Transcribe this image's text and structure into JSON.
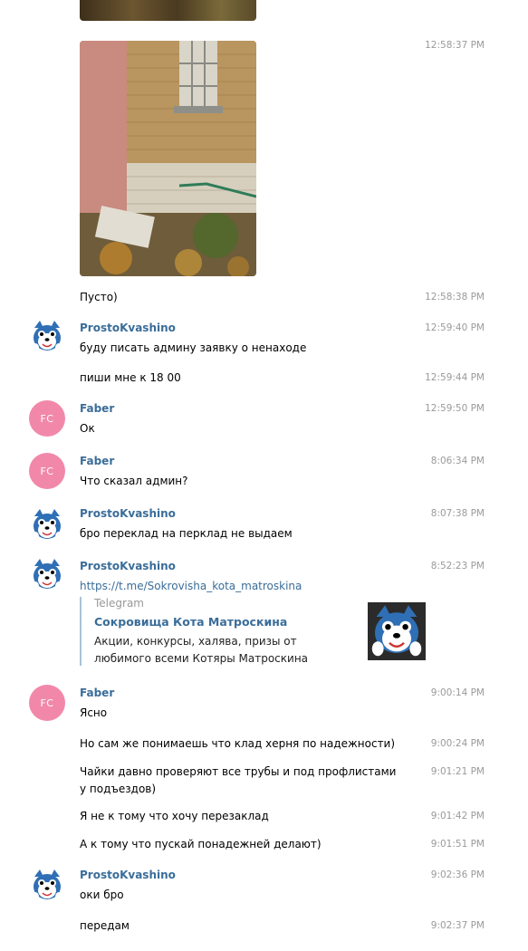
{
  "messages": {
    "m1": {
      "time": "12:58:37 PM"
    },
    "m2": {
      "text": "Пусто)",
      "time": "12:58:38 PM"
    },
    "m3": {
      "name": "ProstoKvashino",
      "text": "буду писать админу заявку о ненаходе",
      "time": "12:59:40 PM"
    },
    "m4": {
      "text": "пиши мне к 18 00",
      "time": "12:59:44 PM"
    },
    "m5": {
      "avatar": "FC",
      "name": "Faber",
      "text": "Ок",
      "time": "12:59:50 PM"
    },
    "m6": {
      "avatar": "FC",
      "name": "Faber",
      "text": "Что сказал админ?",
      "time": "8:06:34 PM"
    },
    "m7": {
      "name": "ProstoKvashino",
      "text": "бро переклад на перклад не выдаем",
      "time": "8:07:38 PM"
    },
    "m8": {
      "name": "ProstoKvashino",
      "link": "https://t.me/Sokrovisha_kota_matroskina",
      "time": "8:52:23 PM",
      "preview": {
        "site": "Telegram",
        "title": "Сокровища Кота Матроскина",
        "description": "Акции, конкурсы, халява, призы от любимого всеми Котяры Матроскина"
      }
    },
    "m9": {
      "avatar": "FC",
      "name": "Faber",
      "text": "Ясно",
      "time": "9:00:14 PM"
    },
    "m10": {
      "text": "Но сам же понимаешь что клад херня по надежности)",
      "time": "9:00:24 PM"
    },
    "m11": {
      "text": "Чайки давно проверяют все трубы и под профлистами у подъездов)",
      "time": "9:01:21 PM"
    },
    "m12": {
      "text": "Я не к тому что хочу перезаклад",
      "time": "9:01:42 PM"
    },
    "m13": {
      "text": "А к тому что пускай понадежней делают)",
      "time": "9:01:51 PM"
    },
    "m14": {
      "name": "ProstoKvashino",
      "text": "оки бро",
      "time": "9:02:36 PM"
    },
    "m15": {
      "text": "передам",
      "time": "9:02:37 PM"
    }
  },
  "colors": {
    "name": "#3a6d99",
    "avatar_fc": "#f288a9",
    "time": "#9a9a9a"
  },
  "icons": {
    "cat_avatar": "matroskin-cat-avatar"
  }
}
